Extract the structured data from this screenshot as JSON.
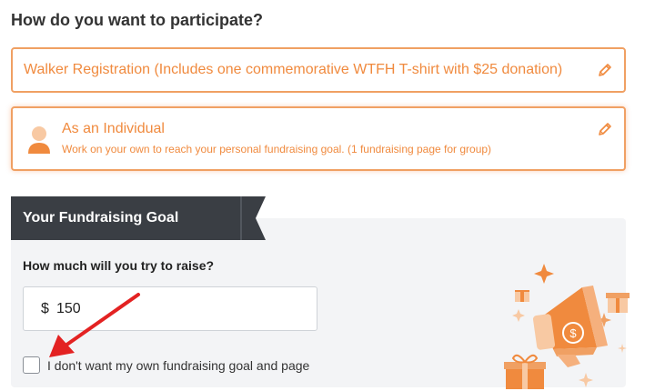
{
  "question": "How do you want to participate?",
  "registration_option": {
    "label": "Walker Registration (Includes one commemorative WTFH T-shirt with $25 donation)"
  },
  "participation_type": {
    "title": "As an Individual",
    "description": "Work on your own to reach your personal fundraising goal. (1 fundraising page for group)"
  },
  "goal_section": {
    "tab_label": "Your Fundraising Goal",
    "question": "How much will you try to raise?",
    "currency_symbol": "$",
    "amount_value": "150",
    "opt_out_label": "I don't want my own fundraising goal and page",
    "opt_out_checked": false
  },
  "colors": {
    "accent": "#f08a3e",
    "border": "#f0a063",
    "tab_bg": "#3a3e44",
    "panel_bg": "#f3f4f6",
    "arrow": "#e32222"
  },
  "icons": [
    "pencil-icon",
    "person-icon",
    "megaphone-illustration",
    "red-arrow-annotation"
  ]
}
